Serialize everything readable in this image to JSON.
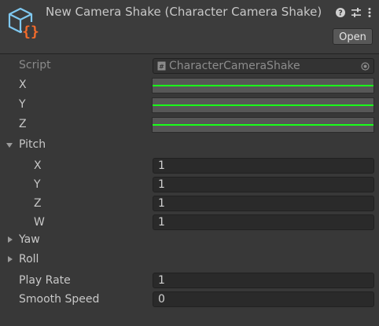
{
  "header": {
    "title": "New Camera Shake (Character Camera Shake)",
    "open_label": "Open",
    "icons": [
      "script-asset-icon",
      "help-icon",
      "preset-icon",
      "kebab-menu-icon"
    ]
  },
  "script": {
    "label": "Script",
    "value": "CharacterCameraShake"
  },
  "curves": [
    {
      "label": "X"
    },
    {
      "label": "Y"
    },
    {
      "label": "Z"
    }
  ],
  "pitch": {
    "label": "Pitch",
    "expanded": true,
    "fields": [
      {
        "label": "X",
        "value": "1"
      },
      {
        "label": "Y",
        "value": "1"
      },
      {
        "label": "Z",
        "value": "1"
      },
      {
        "label": "W",
        "value": "1"
      }
    ]
  },
  "yaw": {
    "label": "Yaw",
    "expanded": false
  },
  "roll": {
    "label": "Roll",
    "expanded": false
  },
  "play_rate": {
    "label": "Play Rate",
    "value": "1"
  },
  "smooth_speed": {
    "label": "Smooth Speed",
    "value": "0"
  },
  "colors": {
    "curve_line": "#1aff1a",
    "background": "#383838",
    "field_bg": "#2a2a2a"
  }
}
